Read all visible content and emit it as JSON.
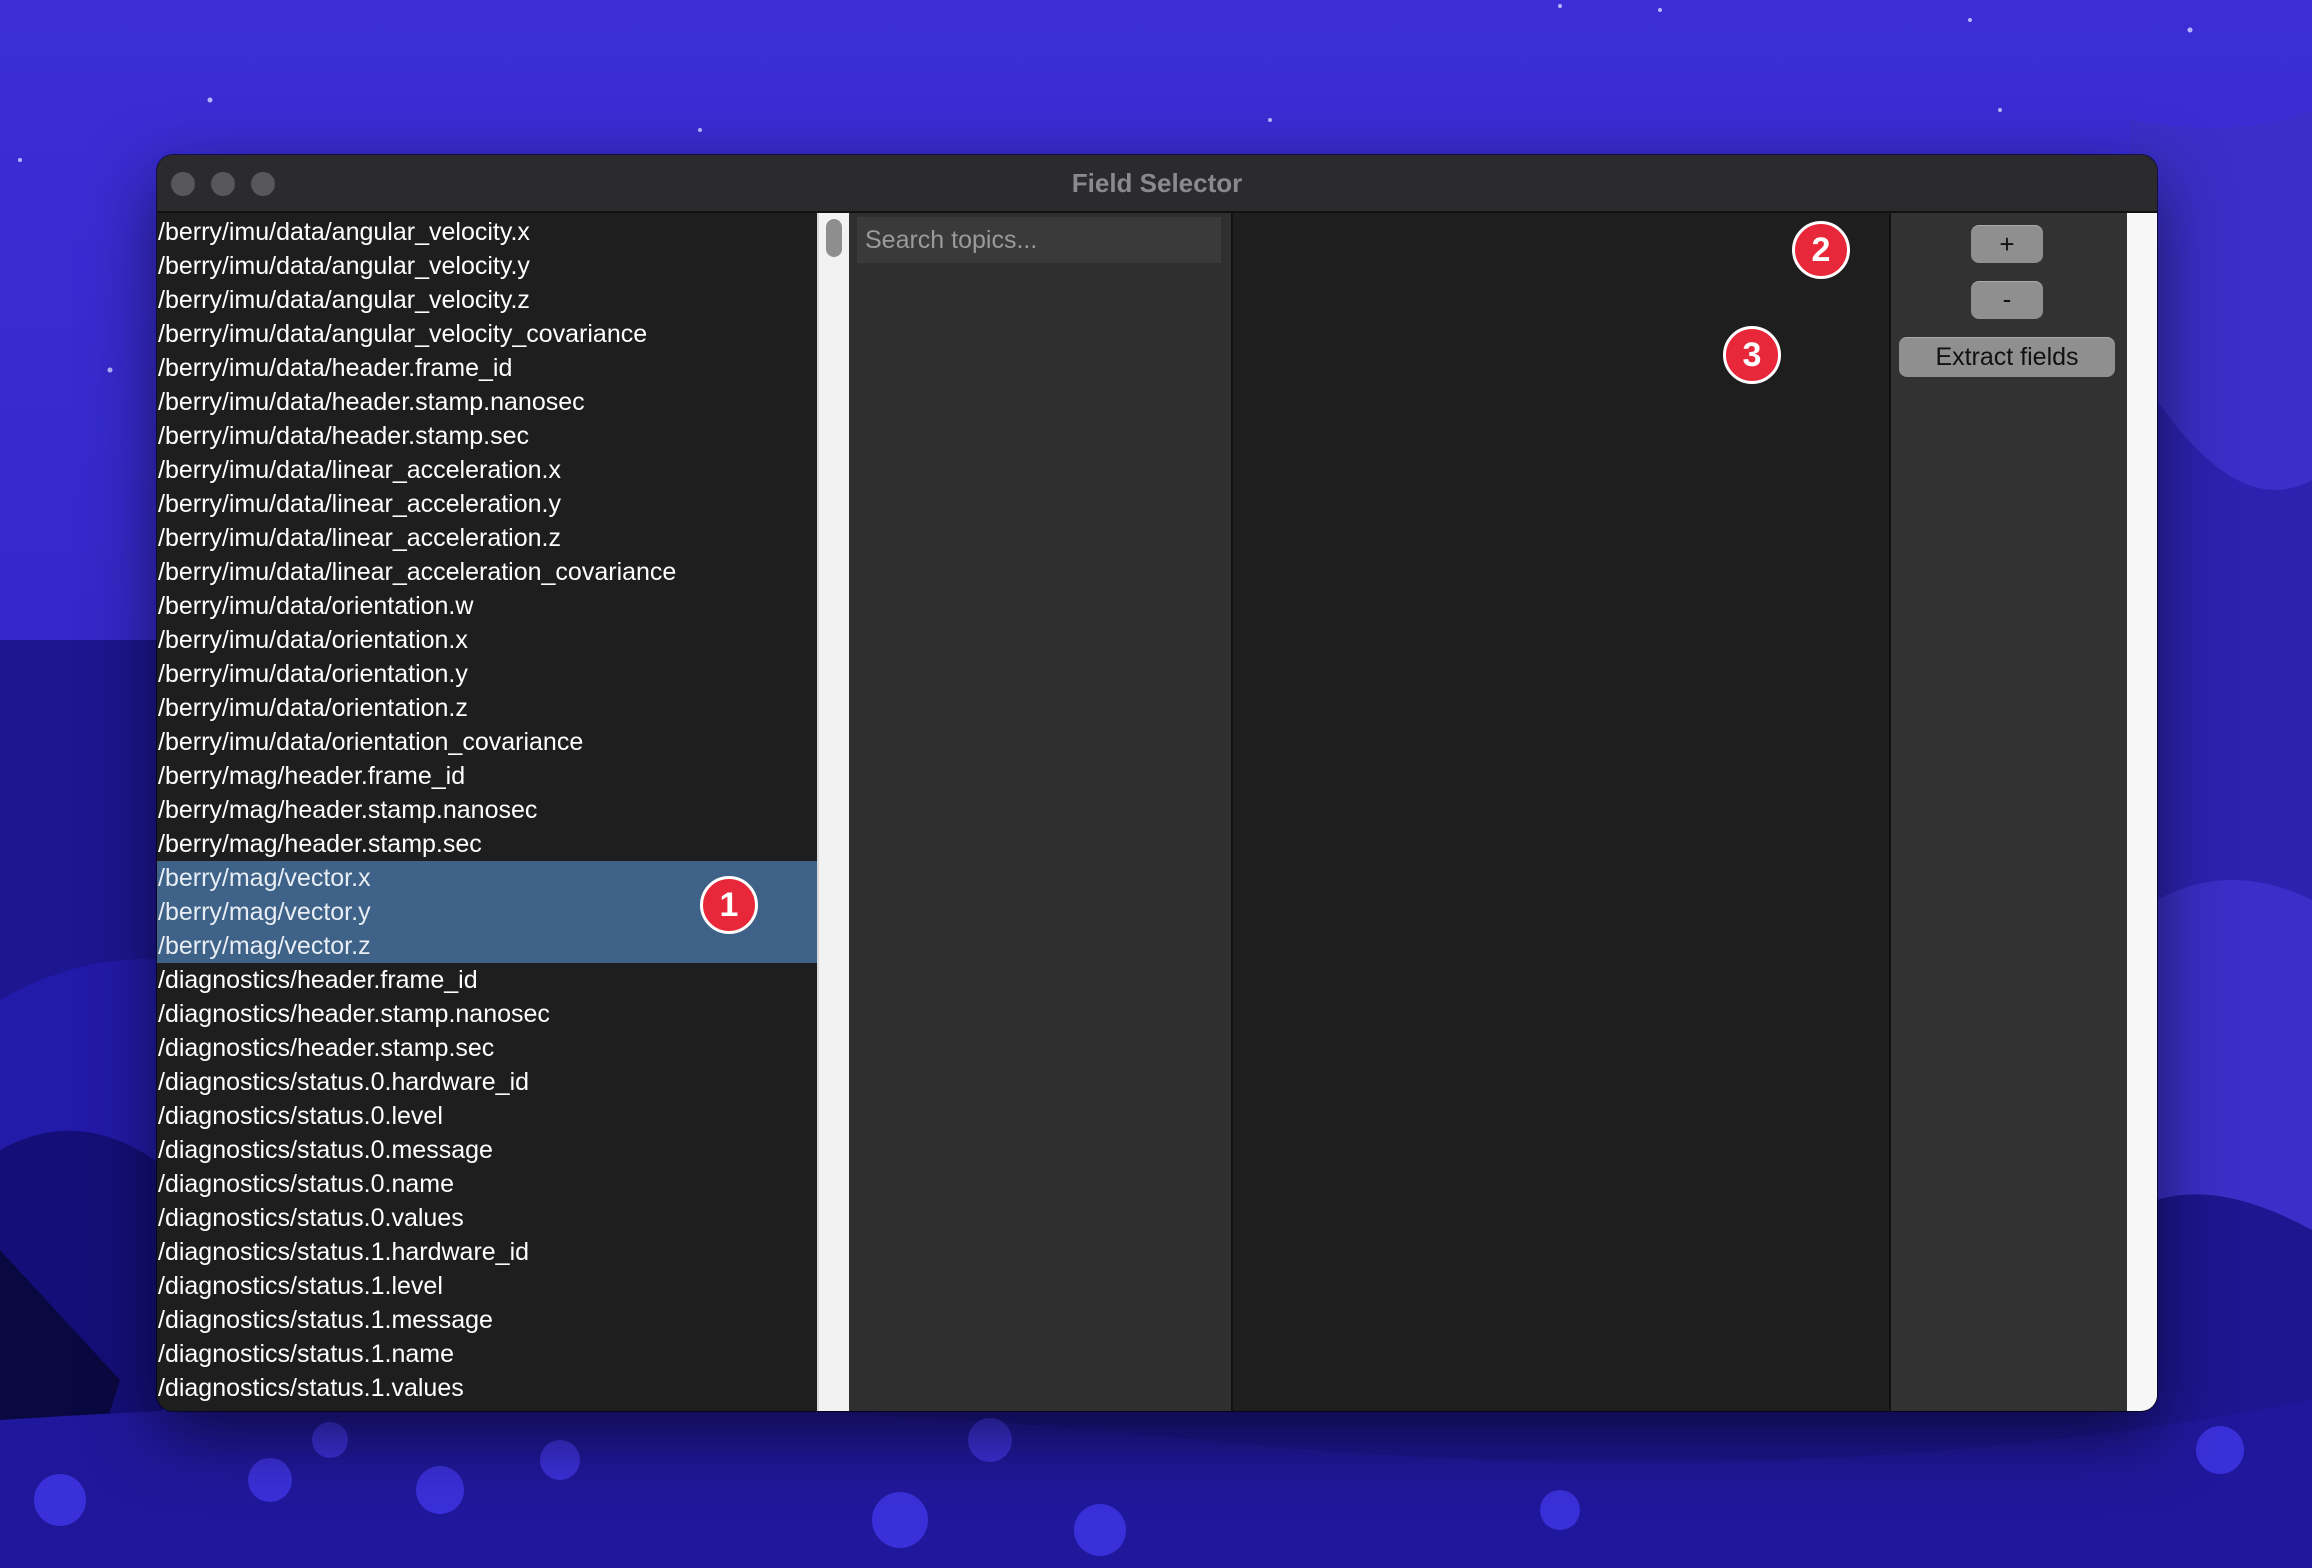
{
  "window": {
    "title": "Field Selector"
  },
  "fields": [
    {
      "label": "/berry/imu/data/angular_velocity.x",
      "selected": false
    },
    {
      "label": "/berry/imu/data/angular_velocity.y",
      "selected": false
    },
    {
      "label": "/berry/imu/data/angular_velocity.z",
      "selected": false
    },
    {
      "label": "/berry/imu/data/angular_velocity_covariance",
      "selected": false
    },
    {
      "label": "/berry/imu/data/header.frame_id",
      "selected": false
    },
    {
      "label": "/berry/imu/data/header.stamp.nanosec",
      "selected": false
    },
    {
      "label": "/berry/imu/data/header.stamp.sec",
      "selected": false
    },
    {
      "label": "/berry/imu/data/linear_acceleration.x",
      "selected": false
    },
    {
      "label": "/berry/imu/data/linear_acceleration.y",
      "selected": false
    },
    {
      "label": "/berry/imu/data/linear_acceleration.z",
      "selected": false
    },
    {
      "label": "/berry/imu/data/linear_acceleration_covariance",
      "selected": false
    },
    {
      "label": "/berry/imu/data/orientation.w",
      "selected": false
    },
    {
      "label": "/berry/imu/data/orientation.x",
      "selected": false
    },
    {
      "label": "/berry/imu/data/orientation.y",
      "selected": false
    },
    {
      "label": "/berry/imu/data/orientation.z",
      "selected": false
    },
    {
      "label": "/berry/imu/data/orientation_covariance",
      "selected": false
    },
    {
      "label": "/berry/mag/header.frame_id",
      "selected": false
    },
    {
      "label": "/berry/mag/header.stamp.nanosec",
      "selected": false
    },
    {
      "label": "/berry/mag/header.stamp.sec",
      "selected": false
    },
    {
      "label": "/berry/mag/vector.x",
      "selected": true
    },
    {
      "label": "/berry/mag/vector.y",
      "selected": true
    },
    {
      "label": "/berry/mag/vector.z",
      "selected": true
    },
    {
      "label": "/diagnostics/header.frame_id",
      "selected": false
    },
    {
      "label": "/diagnostics/header.stamp.nanosec",
      "selected": false
    },
    {
      "label": "/diagnostics/header.stamp.sec",
      "selected": false
    },
    {
      "label": "/diagnostics/status.0.hardware_id",
      "selected": false
    },
    {
      "label": "/diagnostics/status.0.level",
      "selected": false
    },
    {
      "label": "/diagnostics/status.0.message",
      "selected": false
    },
    {
      "label": "/diagnostics/status.0.name",
      "selected": false
    },
    {
      "label": "/diagnostics/status.0.values",
      "selected": false
    },
    {
      "label": "/diagnostics/status.1.hardware_id",
      "selected": false
    },
    {
      "label": "/diagnostics/status.1.level",
      "selected": false
    },
    {
      "label": "/diagnostics/status.1.message",
      "selected": false
    },
    {
      "label": "/diagnostics/status.1.name",
      "selected": false
    },
    {
      "label": "/diagnostics/status.1.values",
      "selected": false
    }
  ],
  "search": {
    "placeholder": "Search topics...",
    "value": ""
  },
  "controls": {
    "add_label": "+",
    "remove_label": "-",
    "extract_label": "Extract fields"
  },
  "annotations": {
    "step1": "1",
    "step2": "2",
    "step3": "3",
    "color": "#e8283a"
  },
  "colors": {
    "selection": "#3e6288",
    "button": "#8f8f8f",
    "desktop": "#2a1fb8"
  }
}
